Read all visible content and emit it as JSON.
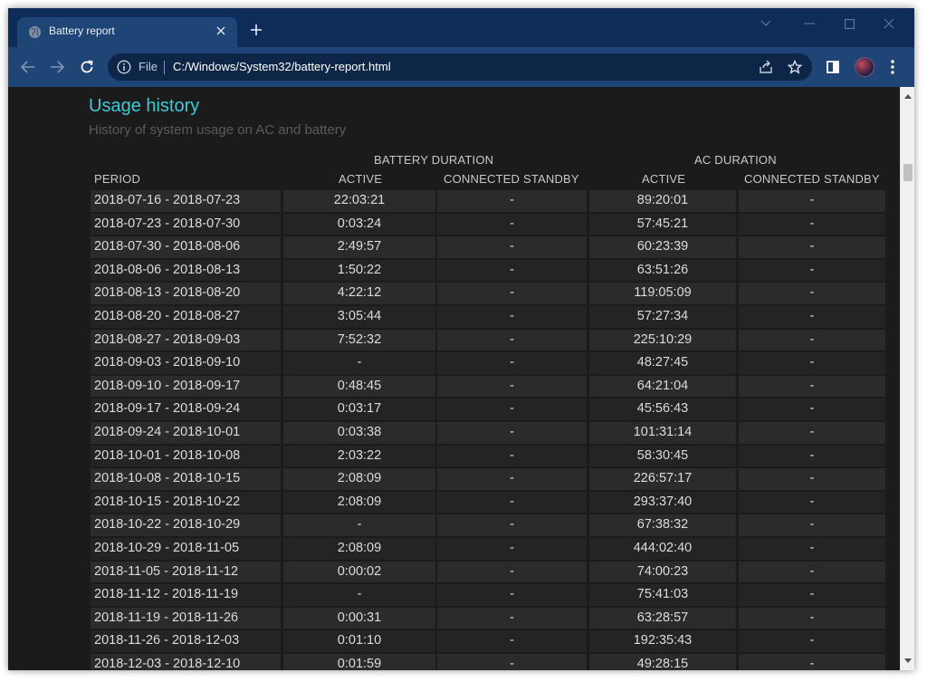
{
  "browser": {
    "tab_title": "Battery report",
    "scheme_label": "File",
    "url": "C:/Windows/System32/battery-report.html"
  },
  "report": {
    "title": "Usage history",
    "subtitle": "History of system usage on AC and battery",
    "group_battery": "BATTERY DURATION",
    "group_ac": "AC DURATION",
    "headers": {
      "period": "PERIOD",
      "battery_active": "ACTIVE",
      "battery_standby": "CONNECTED STANDBY",
      "ac_active": "ACTIVE",
      "ac_standby": "CONNECTED STANDBY"
    },
    "rows": [
      [
        "2018-07-16 - 2018-07-23",
        "22:03:21",
        "-",
        "89:20:01",
        "-"
      ],
      [
        "2018-07-23 - 2018-07-30",
        "0:03:24",
        "-",
        "57:45:21",
        "-"
      ],
      [
        "2018-07-30 - 2018-08-06",
        "2:49:57",
        "-",
        "60:23:39",
        "-"
      ],
      [
        "2018-08-06 - 2018-08-13",
        "1:50:22",
        "-",
        "63:51:26",
        "-"
      ],
      [
        "2018-08-13 - 2018-08-20",
        "4:22:12",
        "-",
        "119:05:09",
        "-"
      ],
      [
        "2018-08-20 - 2018-08-27",
        "3:05:44",
        "-",
        "57:27:34",
        "-"
      ],
      [
        "2018-08-27 - 2018-09-03",
        "7:52:32",
        "-",
        "225:10:29",
        "-"
      ],
      [
        "2018-09-03 - 2018-09-10",
        "-",
        "-",
        "48:27:45",
        "-"
      ],
      [
        "2018-09-10 - 2018-09-17",
        "0:48:45",
        "-",
        "64:21:04",
        "-"
      ],
      [
        "2018-09-17 - 2018-09-24",
        "0:03:17",
        "-",
        "45:56:43",
        "-"
      ],
      [
        "2018-09-24 - 2018-10-01",
        "0:03:38",
        "-",
        "101:31:14",
        "-"
      ],
      [
        "2018-10-01 - 2018-10-08",
        "2:03:22",
        "-",
        "58:30:45",
        "-"
      ],
      [
        "2018-10-08 - 2018-10-15",
        "2:08:09",
        "-",
        "226:57:17",
        "-"
      ],
      [
        "2018-10-15 - 2018-10-22",
        "2:08:09",
        "-",
        "293:37:40",
        "-"
      ],
      [
        "2018-10-22 - 2018-10-29",
        "-",
        "-",
        "67:38:32",
        "-"
      ],
      [
        "2018-10-29 - 2018-11-05",
        "2:08:09",
        "-",
        "444:02:40",
        "-"
      ],
      [
        "2018-11-05 - 2018-11-12",
        "0:00:02",
        "-",
        "74:00:23",
        "-"
      ],
      [
        "2018-11-12 - 2018-11-19",
        "-",
        "-",
        "75:41:03",
        "-"
      ],
      [
        "2018-11-19 - 2018-11-26",
        "0:00:31",
        "-",
        "63:28:57",
        "-"
      ],
      [
        "2018-11-26 - 2018-12-03",
        "0:01:10",
        "-",
        "192:35:43",
        "-"
      ],
      [
        "2018-12-03 - 2018-12-10",
        "0:01:59",
        "-",
        "49:28:15",
        "-"
      ]
    ]
  },
  "colors": {
    "frame": "#0e2c57",
    "toolbar": "#1e4575",
    "accent_title": "#3fcad6",
    "page_bg": "#1b1b1b"
  },
  "icons": {
    "favicon": "globe-icon",
    "tab_close": "close-icon",
    "new_tab": "plus-icon",
    "back": "arrow-left-icon",
    "forward": "arrow-right-icon",
    "reload": "reload-icon",
    "info": "info-icon",
    "share": "share-icon",
    "bookmark": "star-icon",
    "side_panel": "side-panel-icon",
    "menu": "kebab-menu-icon"
  }
}
